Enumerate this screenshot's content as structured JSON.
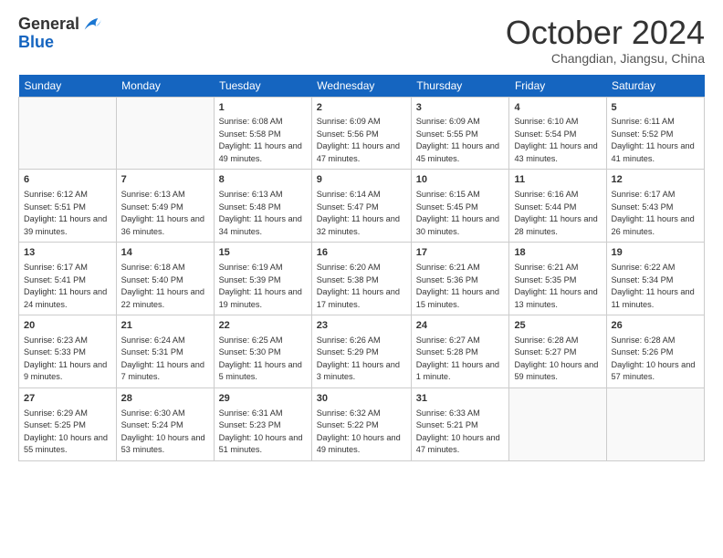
{
  "header": {
    "logo_line1": "General",
    "logo_line2": "Blue",
    "month": "October 2024",
    "location": "Changdian, Jiangsu, China"
  },
  "days_of_week": [
    "Sunday",
    "Monday",
    "Tuesday",
    "Wednesday",
    "Thursday",
    "Friday",
    "Saturday"
  ],
  "weeks": [
    [
      {
        "day": "",
        "empty": true
      },
      {
        "day": "",
        "empty": true
      },
      {
        "day": "1",
        "sunrise": "6:08 AM",
        "sunset": "5:58 PM",
        "daylight": "11 hours and 49 minutes."
      },
      {
        "day": "2",
        "sunrise": "6:09 AM",
        "sunset": "5:56 PM",
        "daylight": "11 hours and 47 minutes."
      },
      {
        "day": "3",
        "sunrise": "6:09 AM",
        "sunset": "5:55 PM",
        "daylight": "11 hours and 45 minutes."
      },
      {
        "day": "4",
        "sunrise": "6:10 AM",
        "sunset": "5:54 PM",
        "daylight": "11 hours and 43 minutes."
      },
      {
        "day": "5",
        "sunrise": "6:11 AM",
        "sunset": "5:52 PM",
        "daylight": "11 hours and 41 minutes."
      }
    ],
    [
      {
        "day": "6",
        "sunrise": "6:12 AM",
        "sunset": "5:51 PM",
        "daylight": "11 hours and 39 minutes."
      },
      {
        "day": "7",
        "sunrise": "6:13 AM",
        "sunset": "5:49 PM",
        "daylight": "11 hours and 36 minutes."
      },
      {
        "day": "8",
        "sunrise": "6:13 AM",
        "sunset": "5:48 PM",
        "daylight": "11 hours and 34 minutes."
      },
      {
        "day": "9",
        "sunrise": "6:14 AM",
        "sunset": "5:47 PM",
        "daylight": "11 hours and 32 minutes."
      },
      {
        "day": "10",
        "sunrise": "6:15 AM",
        "sunset": "5:45 PM",
        "daylight": "11 hours and 30 minutes."
      },
      {
        "day": "11",
        "sunrise": "6:16 AM",
        "sunset": "5:44 PM",
        "daylight": "11 hours and 28 minutes."
      },
      {
        "day": "12",
        "sunrise": "6:17 AM",
        "sunset": "5:43 PM",
        "daylight": "11 hours and 26 minutes."
      }
    ],
    [
      {
        "day": "13",
        "sunrise": "6:17 AM",
        "sunset": "5:41 PM",
        "daylight": "11 hours and 24 minutes."
      },
      {
        "day": "14",
        "sunrise": "6:18 AM",
        "sunset": "5:40 PM",
        "daylight": "11 hours and 22 minutes."
      },
      {
        "day": "15",
        "sunrise": "6:19 AM",
        "sunset": "5:39 PM",
        "daylight": "11 hours and 19 minutes."
      },
      {
        "day": "16",
        "sunrise": "6:20 AM",
        "sunset": "5:38 PM",
        "daylight": "11 hours and 17 minutes."
      },
      {
        "day": "17",
        "sunrise": "6:21 AM",
        "sunset": "5:36 PM",
        "daylight": "11 hours and 15 minutes."
      },
      {
        "day": "18",
        "sunrise": "6:21 AM",
        "sunset": "5:35 PM",
        "daylight": "11 hours and 13 minutes."
      },
      {
        "day": "19",
        "sunrise": "6:22 AM",
        "sunset": "5:34 PM",
        "daylight": "11 hours and 11 minutes."
      }
    ],
    [
      {
        "day": "20",
        "sunrise": "6:23 AM",
        "sunset": "5:33 PM",
        "daylight": "11 hours and 9 minutes."
      },
      {
        "day": "21",
        "sunrise": "6:24 AM",
        "sunset": "5:31 PM",
        "daylight": "11 hours and 7 minutes."
      },
      {
        "day": "22",
        "sunrise": "6:25 AM",
        "sunset": "5:30 PM",
        "daylight": "11 hours and 5 minutes."
      },
      {
        "day": "23",
        "sunrise": "6:26 AM",
        "sunset": "5:29 PM",
        "daylight": "11 hours and 3 minutes."
      },
      {
        "day": "24",
        "sunrise": "6:27 AM",
        "sunset": "5:28 PM",
        "daylight": "11 hours and 1 minute."
      },
      {
        "day": "25",
        "sunrise": "6:28 AM",
        "sunset": "5:27 PM",
        "daylight": "10 hours and 59 minutes."
      },
      {
        "day": "26",
        "sunrise": "6:28 AM",
        "sunset": "5:26 PM",
        "daylight": "10 hours and 57 minutes."
      }
    ],
    [
      {
        "day": "27",
        "sunrise": "6:29 AM",
        "sunset": "5:25 PM",
        "daylight": "10 hours and 55 minutes."
      },
      {
        "day": "28",
        "sunrise": "6:30 AM",
        "sunset": "5:24 PM",
        "daylight": "10 hours and 53 minutes."
      },
      {
        "day": "29",
        "sunrise": "6:31 AM",
        "sunset": "5:23 PM",
        "daylight": "10 hours and 51 minutes."
      },
      {
        "day": "30",
        "sunrise": "6:32 AM",
        "sunset": "5:22 PM",
        "daylight": "10 hours and 49 minutes."
      },
      {
        "day": "31",
        "sunrise": "6:33 AM",
        "sunset": "5:21 PM",
        "daylight": "10 hours and 47 minutes."
      },
      {
        "day": "",
        "empty": true
      },
      {
        "day": "",
        "empty": true
      }
    ]
  ]
}
